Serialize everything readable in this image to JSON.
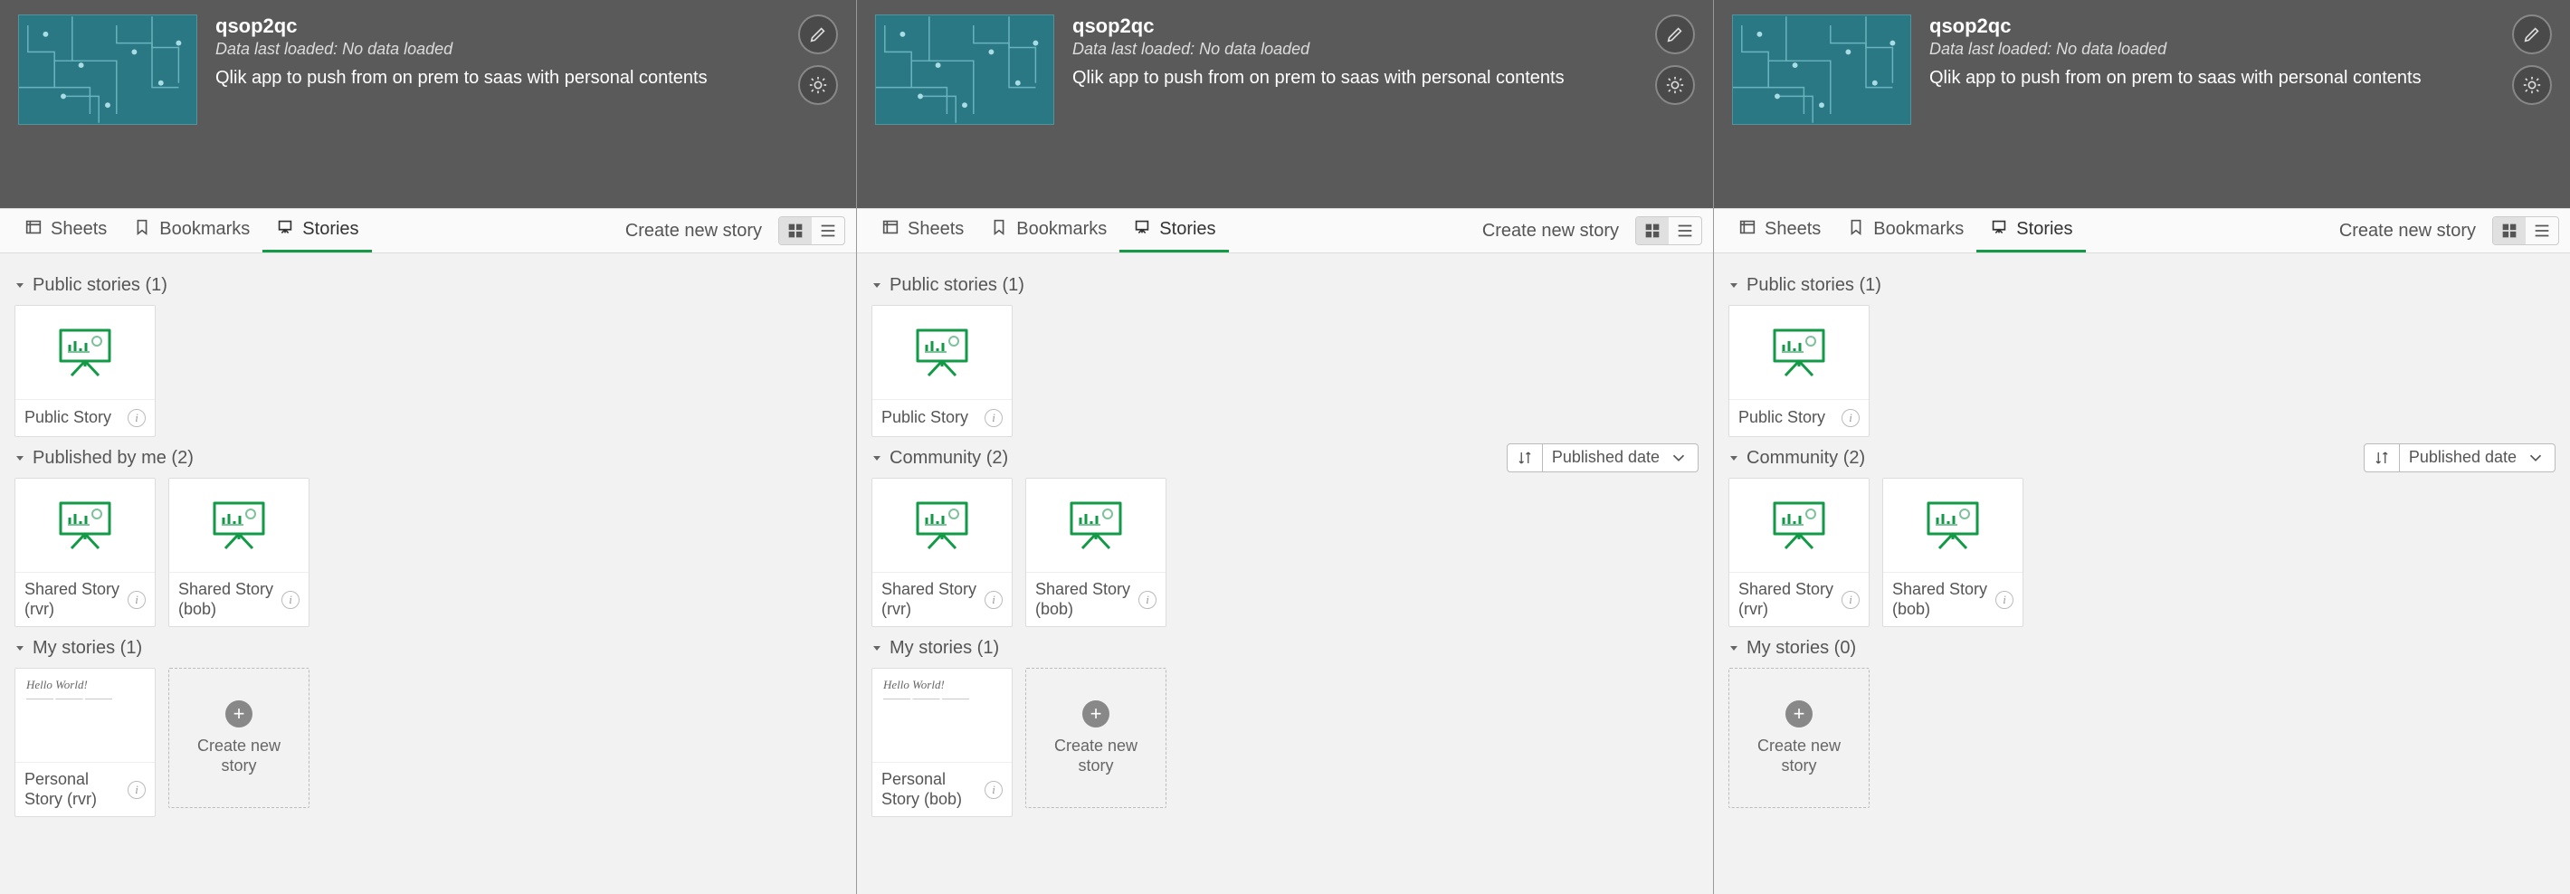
{
  "app": {
    "title": "qsop2qc",
    "last_loaded": "Data last loaded: No data loaded",
    "description": "Qlik app to push from on prem to saas with personal contents"
  },
  "toolbar": {
    "sheets": "Sheets",
    "bookmarks": "Bookmarks",
    "stories": "Stories",
    "create": "Create new story"
  },
  "sort": {
    "label": "Published date"
  },
  "create_card": "Create new story",
  "panels": [
    {
      "groups": [
        {
          "label": "Public stories (1)",
          "showSort": false,
          "stories": [
            {
              "title": "Public Story",
              "thumb": "story"
            }
          ]
        },
        {
          "label": "Published by me (2)",
          "showSort": false,
          "stories": [
            {
              "title": "Shared Story (rvr)",
              "thumb": "story"
            },
            {
              "title": "Shared Story (bob)",
              "thumb": "story"
            }
          ]
        },
        {
          "label": "My stories (1)",
          "showSort": false,
          "create": true,
          "stories": [
            {
              "title": "Personal Story (rvr)",
              "thumb": "personal",
              "double": true
            }
          ]
        }
      ]
    },
    {
      "groups": [
        {
          "label": "Public stories (1)",
          "showSort": false,
          "stories": [
            {
              "title": "Public Story",
              "thumb": "story"
            }
          ]
        },
        {
          "label": "Community (2)",
          "showSort": true,
          "stories": [
            {
              "title": "Shared Story (rvr)",
              "thumb": "story"
            },
            {
              "title": "Shared Story (bob)",
              "thumb": "story"
            }
          ]
        },
        {
          "label": "My stories (1)",
          "showSort": false,
          "create": true,
          "stories": [
            {
              "title": "Personal Story (bob)",
              "thumb": "personal",
              "double": true
            }
          ]
        }
      ]
    },
    {
      "groups": [
        {
          "label": "Public stories (1)",
          "showSort": false,
          "stories": [
            {
              "title": "Public Story",
              "thumb": "story"
            }
          ]
        },
        {
          "label": "Community (2)",
          "showSort": true,
          "stories": [
            {
              "title": "Shared Story (rvr)",
              "thumb": "story"
            },
            {
              "title": "Shared Story (bob)",
              "thumb": "story"
            }
          ]
        },
        {
          "label": "My stories (0)",
          "showSort": false,
          "create": true,
          "stories": []
        }
      ]
    }
  ]
}
